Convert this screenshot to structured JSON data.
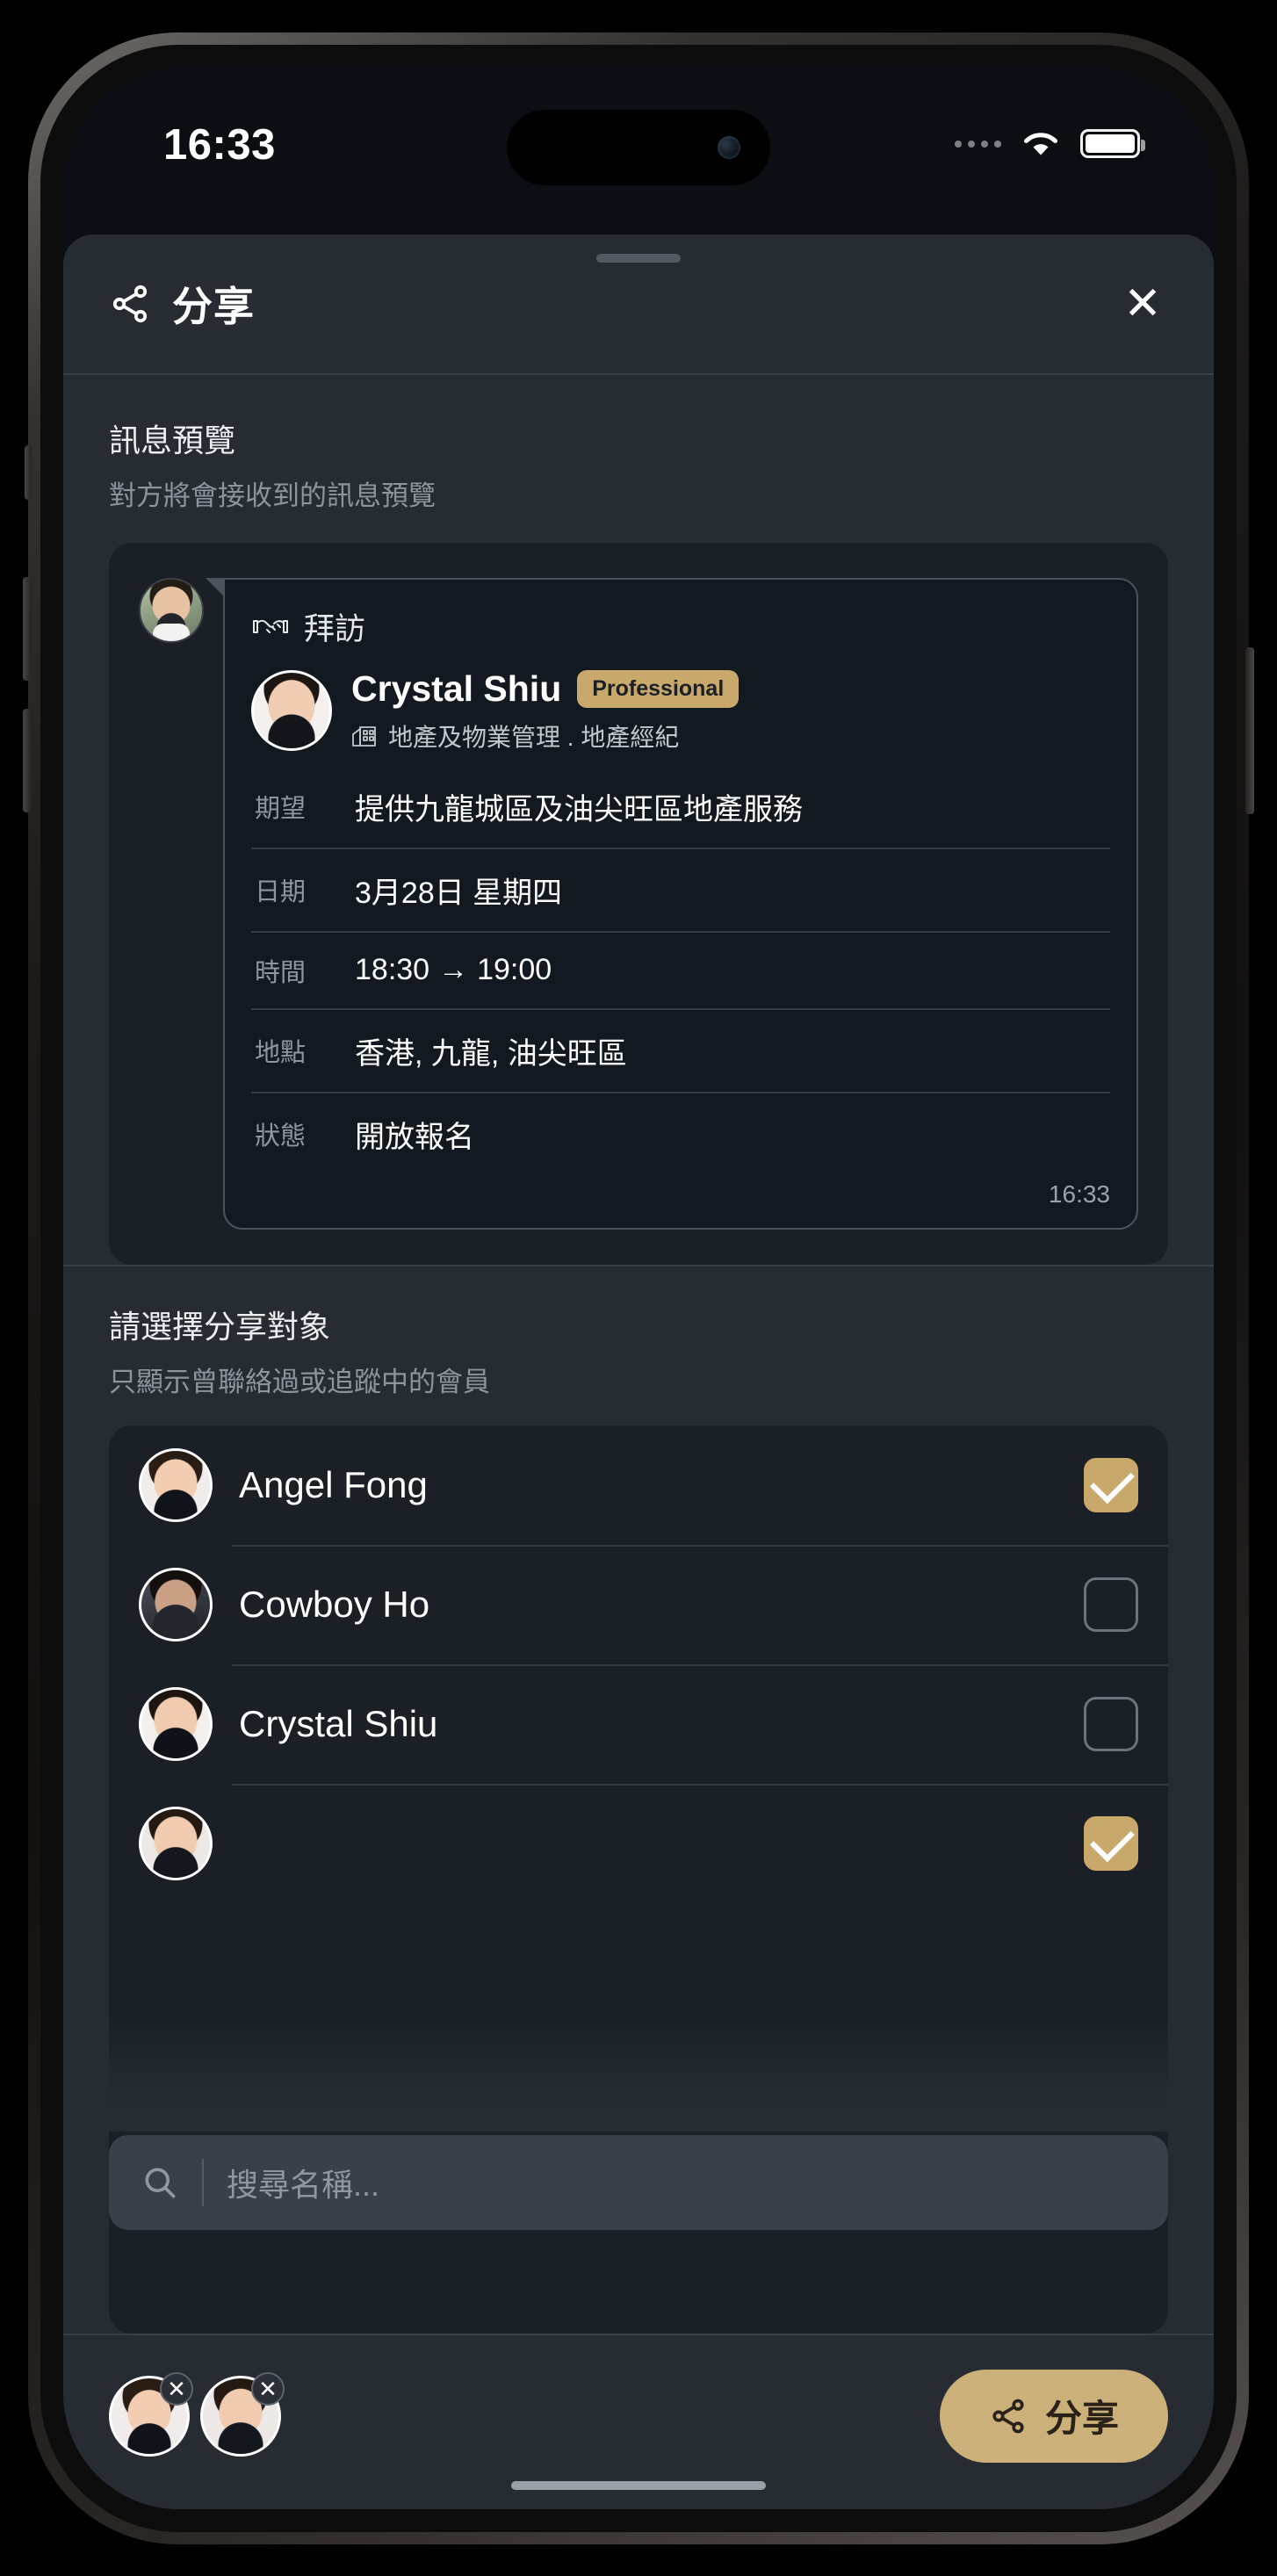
{
  "status_bar": {
    "time": "16:33",
    "wifi_icon": "wifi-icon",
    "battery_icon": "battery-icon"
  },
  "header": {
    "title": "分享",
    "share_icon": "share-nodes-icon",
    "close_label": "✕"
  },
  "preview": {
    "title": "訊息預覽",
    "subtitle": "對方將會接收到的訊息預覽",
    "bubble": {
      "type_icon": "handshake-icon",
      "type_label": "拜訪",
      "person_name": "Crystal Shiu",
      "person_badge": "Professional",
      "industry_icon": "building-icon",
      "person_industry": "地產及物業管理 . 地產經紀",
      "rows": [
        {
          "label": "期望",
          "value": "提供九龍城區及油尖旺區地產服務"
        },
        {
          "label": "日期",
          "value": "3月28日 星期四"
        },
        {
          "label": "時間",
          "value": "18:30",
          "arrow": "→",
          "value2": "19:00"
        },
        {
          "label": "地點",
          "value": "香港, 九龍, 油尖旺區"
        },
        {
          "label": "狀態",
          "value": "開放報名"
        }
      ],
      "timestamp": "16:33"
    }
  },
  "targets": {
    "title": "請選擇分享對象",
    "subtitle": "只顯示曾聯絡過或追蹤中的會員",
    "members": [
      {
        "name": "Angel Fong",
        "checked": true
      },
      {
        "name": "Cowboy Ho",
        "checked": false
      },
      {
        "name": "Crystal Shiu",
        "checked": false
      },
      {
        "name": "",
        "checked": true
      }
    ]
  },
  "search": {
    "placeholder": "搜尋名稱...",
    "icon": "search-icon"
  },
  "action_bar": {
    "selected_chips": [
      {
        "remove_label": "✕"
      },
      {
        "remove_label": "✕"
      }
    ],
    "share_button": {
      "label": "分享",
      "icon": "share-nodes-icon"
    }
  },
  "colors": {
    "accent_gold": "#c8a96b",
    "sheet_bg": "#272c33",
    "card_bg": "#1b1f26",
    "bubble_bg": "#131920"
  }
}
